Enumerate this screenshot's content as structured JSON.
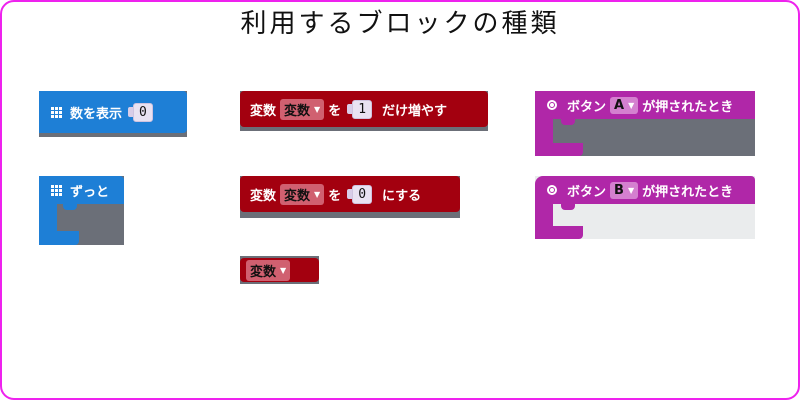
{
  "page": {
    "title": "利用するブロックの種類"
  },
  "blocks": {
    "show_number": {
      "label": "数を表示",
      "value": "0",
      "icon": "grid-icon"
    },
    "forever": {
      "label": "ずっと",
      "icon": "grid-icon"
    },
    "change_var": {
      "var_label": "変数",
      "var_name": "変数",
      "mid": "を",
      "value": "1",
      "tail": "だけ増やす"
    },
    "set_var": {
      "var_label": "変数",
      "var_name": "変数",
      "mid": "を",
      "value": "0",
      "tail": "にする"
    },
    "var_reporter": {
      "var_name": "変数"
    },
    "button_a": {
      "label": "ボタン",
      "button": "A",
      "tail": "が押されたとき",
      "icon": "radio-icon"
    },
    "button_b": {
      "label": "ボタン",
      "button": "B",
      "tail": "が押されたとき",
      "icon": "radio-icon"
    }
  },
  "colors": {
    "basic": "#1e7fd6",
    "variables": "#a3000f",
    "input": "#b027a8",
    "frame": "#ee22ee"
  }
}
